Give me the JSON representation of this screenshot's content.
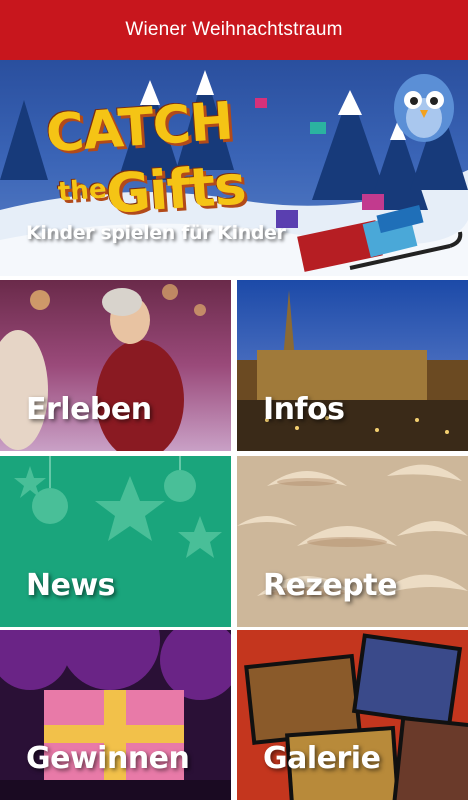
{
  "app_bar": {
    "title": "Wiener Weihnachtstraum"
  },
  "hero": {
    "logo_lines": [
      "CATCH",
      "the",
      "Gifts"
    ],
    "tagline": "Kinder spielen für Kinder"
  },
  "tiles": [
    {
      "label": "Erleben"
    },
    {
      "label": "Infos"
    },
    {
      "label": "News"
    },
    {
      "label": "Rezepte"
    },
    {
      "label": "Gewinnen"
    },
    {
      "label": "Galerie"
    }
  ],
  "colors": {
    "app_bar": "#c8161d",
    "logo_yellow": "#f5c415",
    "news_green": "#1aa57c"
  }
}
